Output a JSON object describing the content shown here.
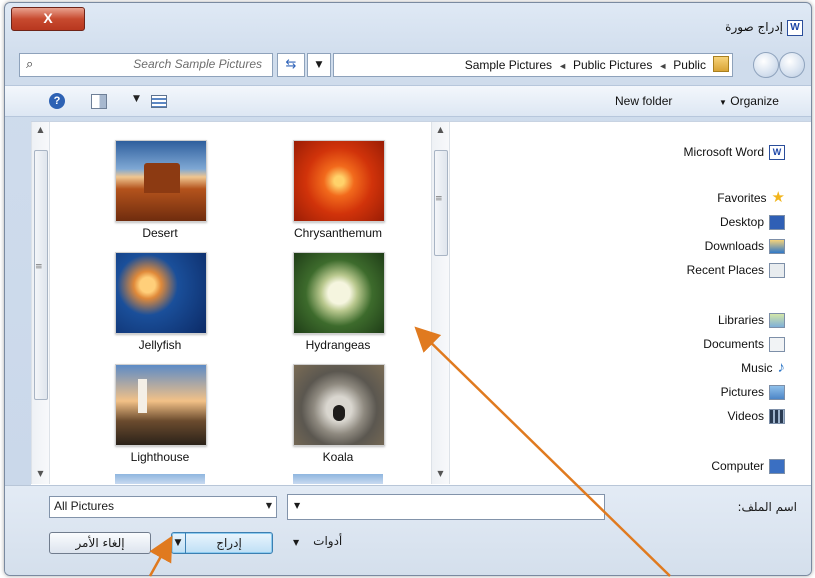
{
  "window": {
    "title": "إدراج صورة",
    "app_icon": "W",
    "close_label": "X"
  },
  "search": {
    "placeholder": "Search Sample Pictures"
  },
  "address": {
    "crumbs": [
      "Public",
      "Public Pictures",
      "Sample Pictures"
    ],
    "overflow": "»"
  },
  "toolbar": {
    "new_folder": "New folder",
    "organize": "Organize",
    "help": "?"
  },
  "files": [
    {
      "name": "Desert"
    },
    {
      "name": "Chrysanthemum"
    },
    {
      "name": "Jellyfish"
    },
    {
      "name": "Hydrangeas"
    },
    {
      "name": "Lighthouse"
    },
    {
      "name": "Koala"
    }
  ],
  "nav": {
    "top": "Microsoft Word",
    "favorites": {
      "label": "Favorites",
      "items": [
        "Desktop",
        "Downloads",
        "Recent Places"
      ]
    },
    "libraries": {
      "label": "Libraries",
      "items": [
        "Documents",
        "Music",
        "Pictures",
        "Videos"
      ]
    },
    "computer": "Computer"
  },
  "footer": {
    "filename_label": "اسم الملف:",
    "filename_value": "",
    "filter": "All Pictures",
    "tools": "أدوات",
    "insert": "إدراج",
    "cancel": "إلغاء الأمر"
  },
  "colors": {
    "annotation_arrow": "#e07a1f",
    "title_close": "#c74a2f"
  }
}
